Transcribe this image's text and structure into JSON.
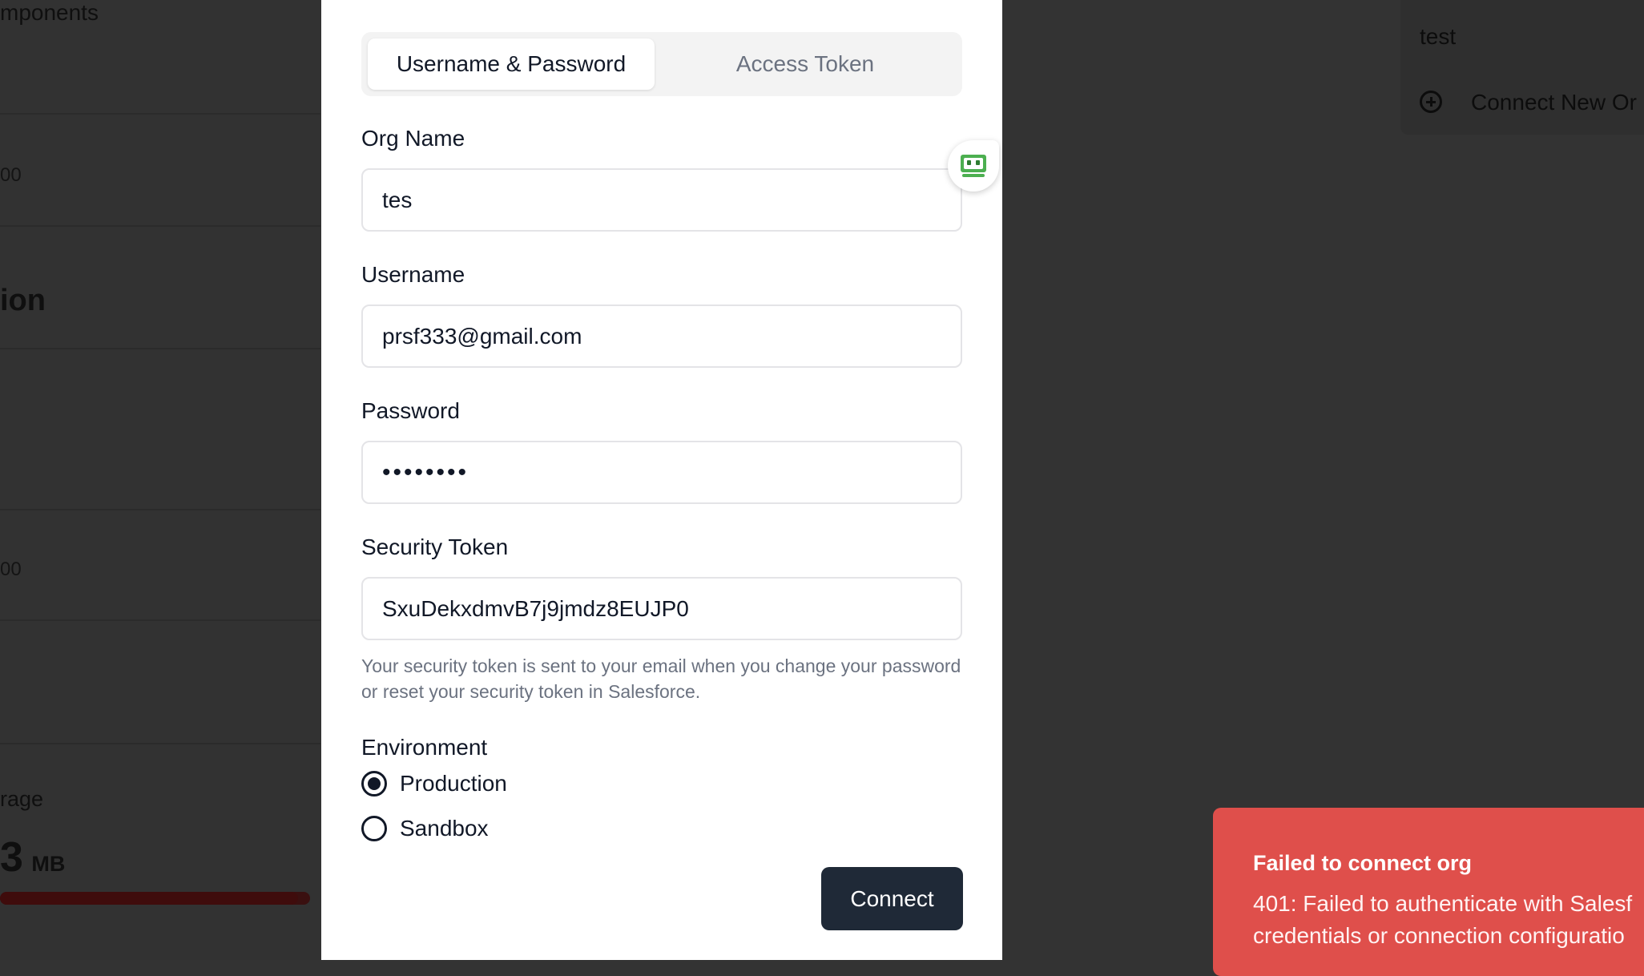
{
  "background": {
    "components_label": "mponents",
    "value_1": "00",
    "section_heading": "ion",
    "value_2": "00",
    "storage_label": "rage",
    "storage_value": "3",
    "storage_unit": "MB",
    "storage_progress_fraction": 0.96,
    "dropdown": {
      "items": [
        "test"
      ],
      "connect_new": "Connect New Or"
    }
  },
  "modal": {
    "tabs": [
      {
        "label": "Username & Password",
        "active": true
      },
      {
        "label": "Access Token",
        "active": false
      }
    ],
    "fields": {
      "org_name": {
        "label": "Org Name",
        "value": "tes"
      },
      "username": {
        "label": "Username",
        "value": "prsf333@gmail.com"
      },
      "password": {
        "label": "Password",
        "value": "••••••••"
      },
      "security_token": {
        "label": "Security Token",
        "value": "SxuDekxdmvB7j9jmdz8EUJP0"
      }
    },
    "security_hint": "Your security token is sent to your email when you change your password or reset your security token in Salesforce.",
    "environment": {
      "label": "Environment",
      "options": [
        {
          "label": "Production",
          "selected": true
        },
        {
          "label": "Sandbox",
          "selected": false
        }
      ]
    },
    "connect_label": "Connect"
  },
  "toast": {
    "title": "Failed to connect org",
    "message": "401: Failed to authenticate with Salesf\ncredentials or connection configuratio"
  },
  "colors": {
    "primary_button": "#1f2937",
    "toast_error": "#df4f4b",
    "extension_icon": "#4caf50"
  },
  "icons": {
    "extension": "robot-icon",
    "add": "plus-circle-icon"
  }
}
